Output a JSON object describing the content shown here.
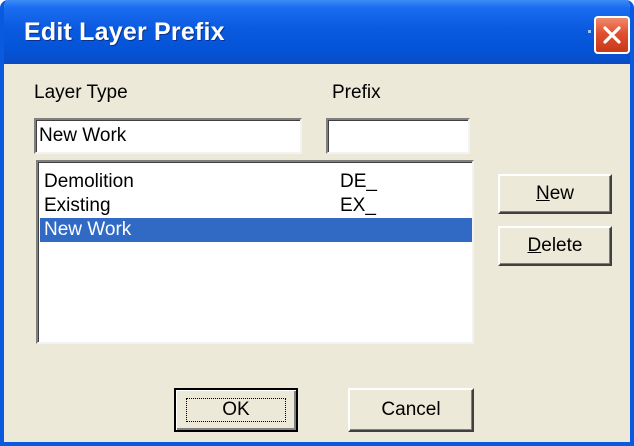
{
  "window": {
    "title": "Edit Layer Prefix"
  },
  "labels": {
    "layer_type": "Layer Type",
    "prefix": "Prefix"
  },
  "inputs": {
    "layer_type_value": "New Work",
    "prefix_value": ""
  },
  "list": {
    "items": [
      {
        "name": "Demolition",
        "prefix": "DE_"
      },
      {
        "name": "Existing",
        "prefix": "EX_"
      },
      {
        "name": "New Work",
        "prefix": ""
      }
    ],
    "selected_index": 2
  },
  "buttons": {
    "new_mnemonic": "N",
    "new_rest": "ew",
    "delete_mnemonic": "D",
    "delete_rest": "elete",
    "ok": "OK",
    "cancel": "Cancel"
  },
  "colors": {
    "titlebar": "#0a5ae0",
    "selection": "#316ac5",
    "dialog_face": "#ece9d8",
    "close_button": "#e0502e"
  }
}
